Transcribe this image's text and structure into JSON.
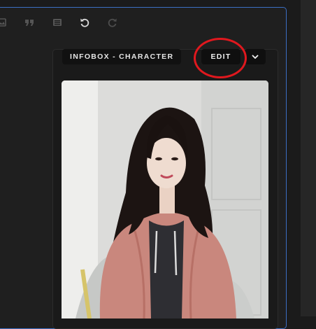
{
  "toolbar": {
    "icons": [
      "image-icon",
      "quote-icon",
      "gallery-icon",
      "undo-icon",
      "redo-icon"
    ]
  },
  "infobox": {
    "label": "INFOBOX - CHARACTER",
    "edit_label": "EDIT",
    "dropdown_icon": "chevron-down-icon"
  },
  "photo": {
    "subject": "character-portrait"
  },
  "colors": {
    "editor_border": "#3c6fc4",
    "highlight_ring": "#e0181e",
    "background": "#1b1b1b"
  }
}
